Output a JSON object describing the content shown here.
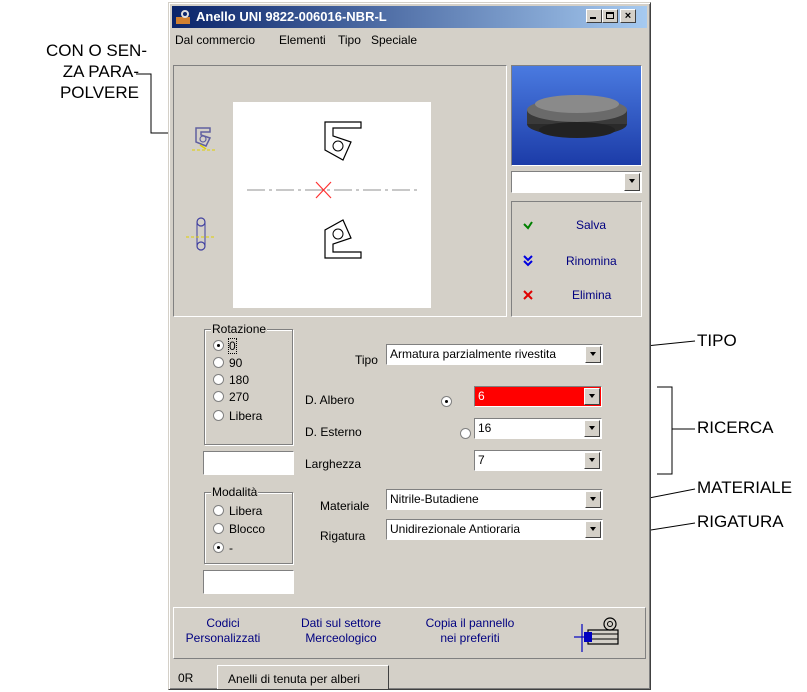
{
  "window": {
    "title": "Anello UNI 9822-006016-NBR-L"
  },
  "menu": [
    "Dal commercio",
    "Elementi",
    "Tipo",
    "Speciale"
  ],
  "actions": {
    "save": "Salva",
    "rename": "Rinomina",
    "delete": "Elimina"
  },
  "rotation": {
    "title": "Rotazione",
    "options": [
      "0",
      "90",
      "180",
      "270",
      "Libera"
    ],
    "selected": "0"
  },
  "mode": {
    "title": "Modalità",
    "options": [
      "Libera",
      "Blocco",
      "-"
    ],
    "selected": "-"
  },
  "form": {
    "tipo_label": "Tipo",
    "tipo_value": "Armatura parzialmente rivestita",
    "albero_label": "D. Albero",
    "albero_value": "6",
    "esterno_label": "D. Esterno",
    "esterno_value": "16",
    "larghezza_label": "Larghezza",
    "larghezza_value": "7",
    "materiale_label": "Materiale",
    "materiale_value": "Nitrile-Butadiene",
    "rigatura_label": "Rigatura",
    "rigatura_value": "Unidirezionale Antioraria"
  },
  "footer": {
    "codici_line1": "Codici",
    "codici_line2": "Personalizzati",
    "dati_line1": "Dati sul settore",
    "dati_line2": "Merceologico",
    "copia_line1": "Copia il pannello",
    "copia_line2": "nei preferiti"
  },
  "tabs": [
    "0R",
    "Anelli di tenuta per alberi"
  ],
  "callouts": {
    "left_line1": "CON O SEN-",
    "left_line2": "ZA PARA-",
    "left_line3": "POLVERE",
    "tipo": "TIPO",
    "ricerca": "RICERCA",
    "materiale": "MATERIALE",
    "rigatura": "RIGATURA"
  },
  "colors": {
    "titlebar_start": "#0a246a",
    "highlight_field": "#ff0000",
    "link": "#000080"
  }
}
